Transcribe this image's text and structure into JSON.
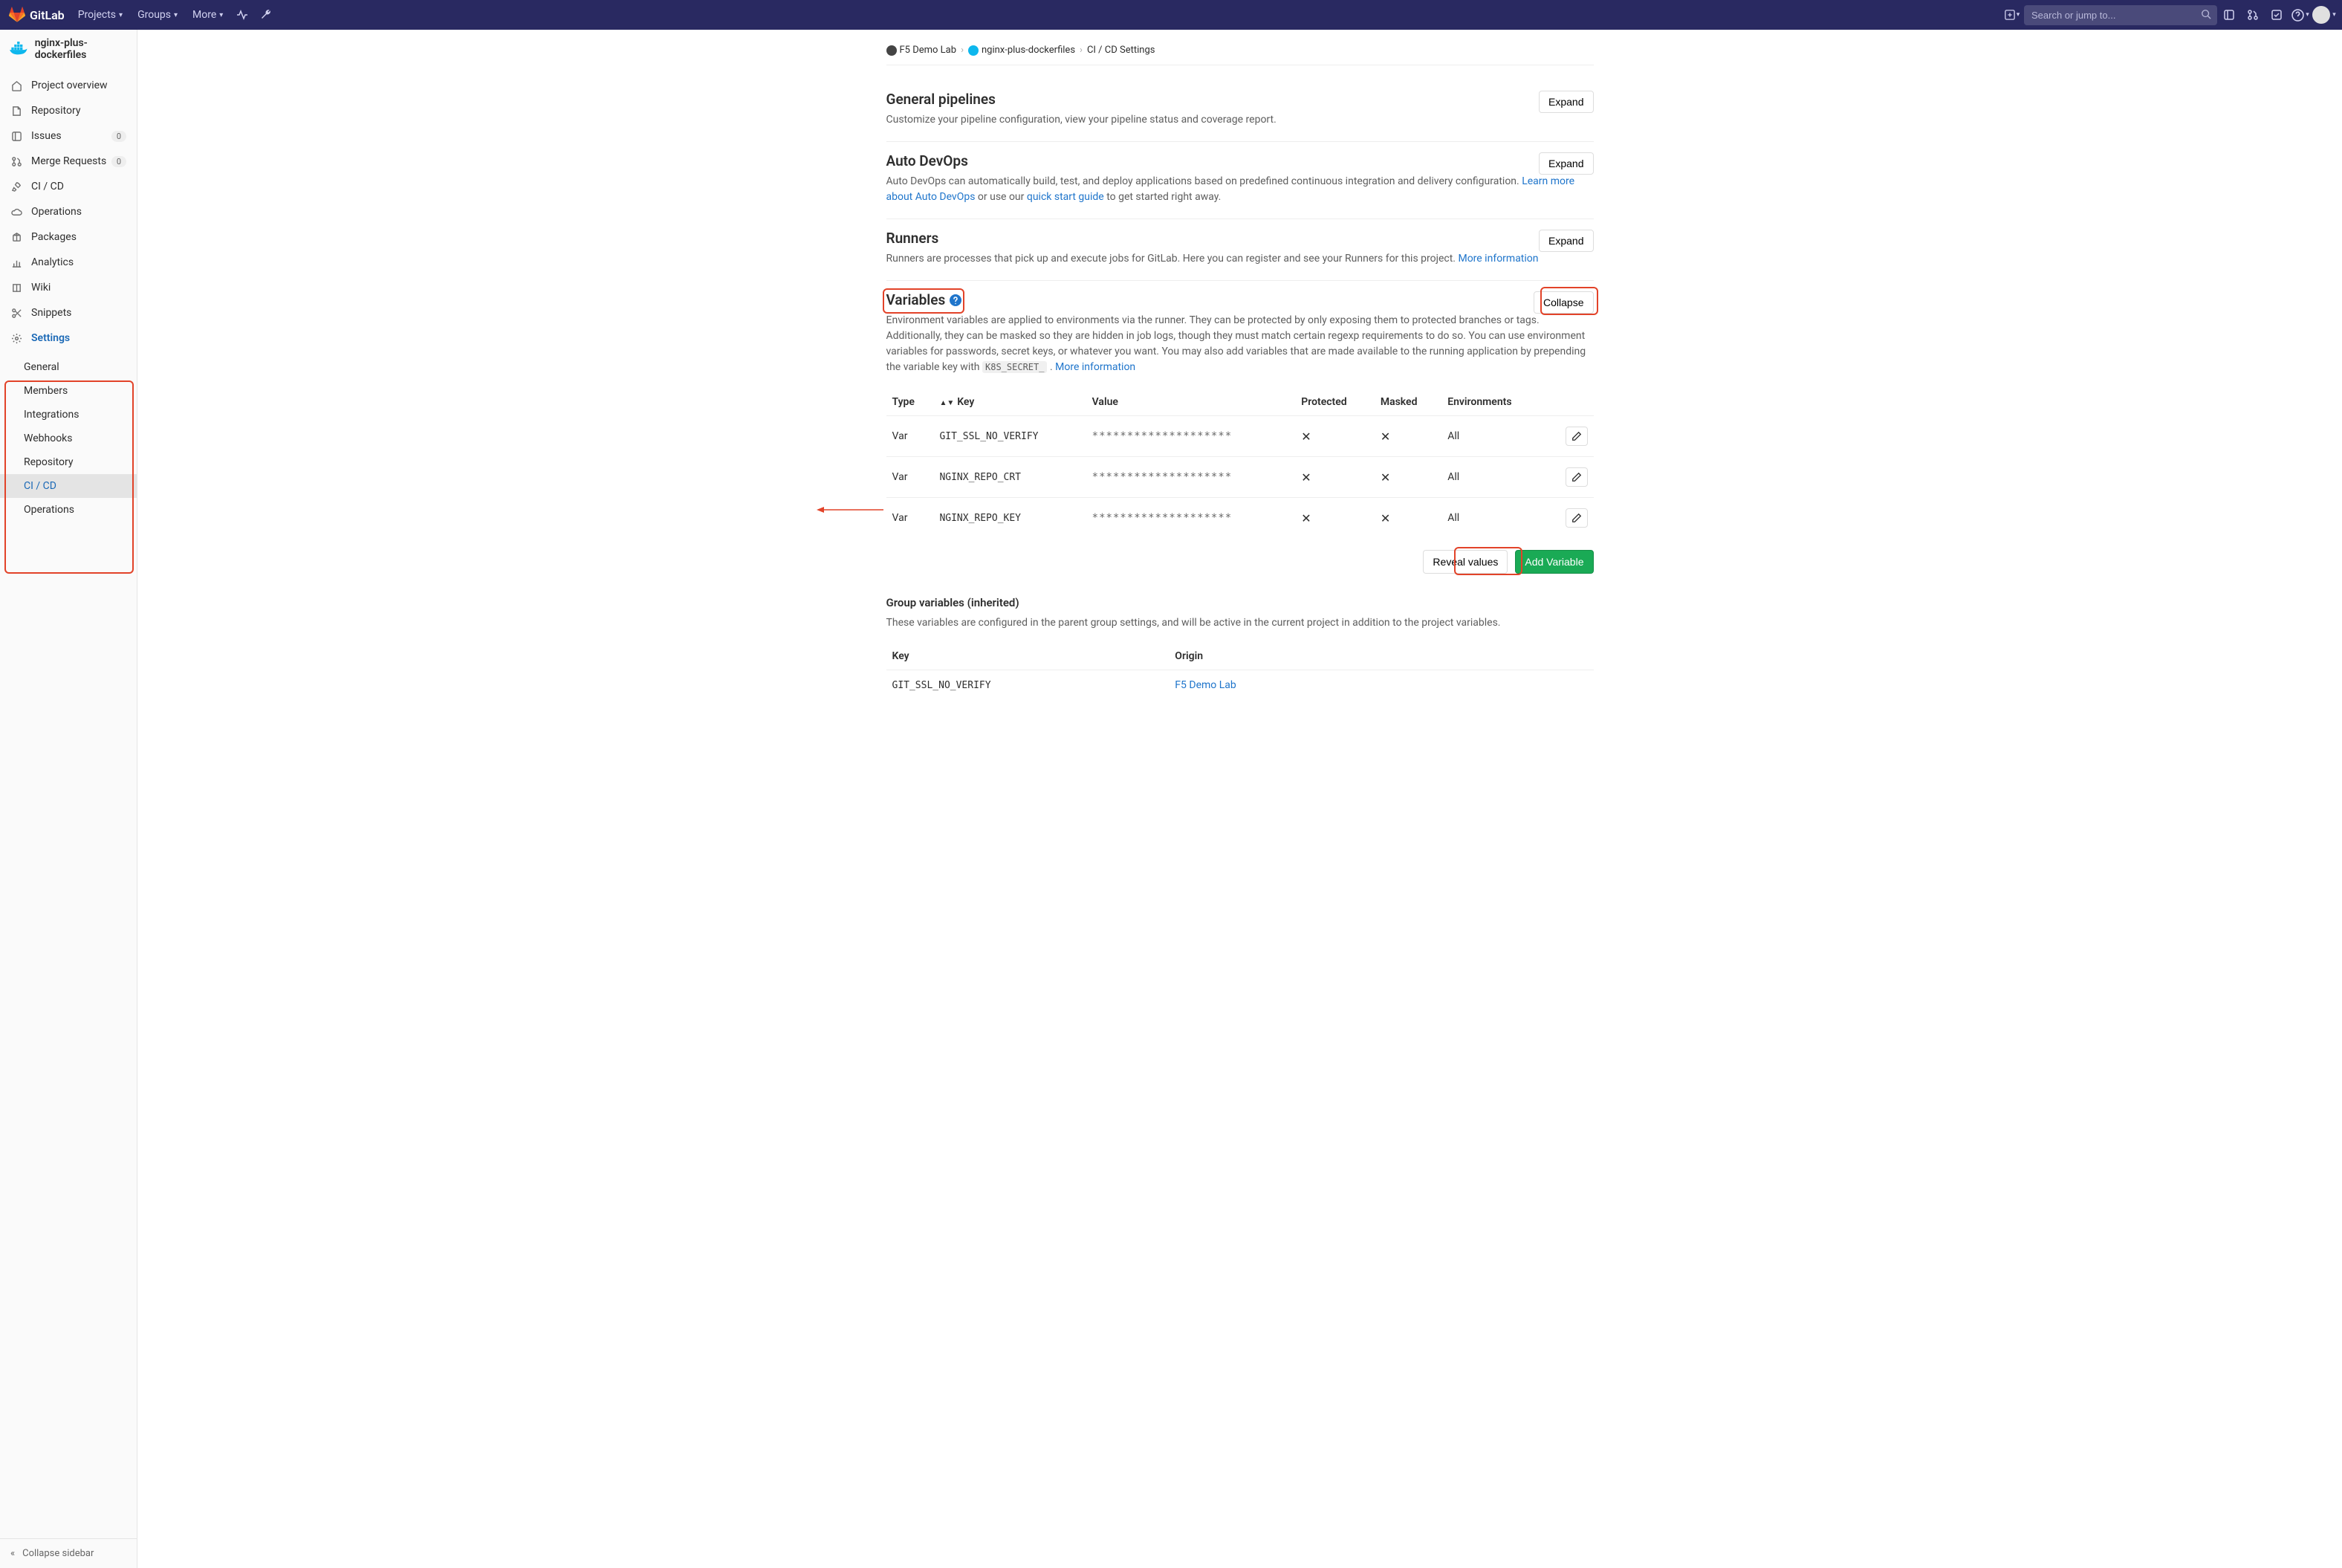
{
  "topnav": {
    "brand": "GitLab",
    "items": [
      "Projects",
      "Groups",
      "More"
    ],
    "search_placeholder": "Search or jump to..."
  },
  "sidebar": {
    "project_name": "nginx-plus-dockerfiles",
    "items": [
      {
        "label": "Project overview",
        "icon": "home",
        "badge": null
      },
      {
        "label": "Repository",
        "icon": "file",
        "badge": null
      },
      {
        "label": "Issues",
        "icon": "issues",
        "badge": "0"
      },
      {
        "label": "Merge Requests",
        "icon": "merge",
        "badge": "0"
      },
      {
        "label": "CI / CD",
        "icon": "rocket",
        "badge": null
      },
      {
        "label": "Operations",
        "icon": "cloud",
        "badge": null
      },
      {
        "label": "Packages",
        "icon": "package",
        "badge": null
      },
      {
        "label": "Analytics",
        "icon": "chart",
        "badge": null
      },
      {
        "label": "Wiki",
        "icon": "book",
        "badge": null
      },
      {
        "label": "Snippets",
        "icon": "scissors",
        "badge": null
      },
      {
        "label": "Settings",
        "icon": "gear",
        "badge": null,
        "active": true
      }
    ],
    "subitems": [
      "General",
      "Members",
      "Integrations",
      "Webhooks",
      "Repository",
      "CI / CD",
      "Operations"
    ],
    "active_sub": "CI / CD",
    "collapse_label": "Collapse sidebar"
  },
  "breadcrumbs": {
    "crumb1": "F5 Demo Lab",
    "crumb2": "nginx-plus-dockerfiles",
    "crumb3": "CI / CD Settings"
  },
  "sections": {
    "general": {
      "title": "General pipelines",
      "desc": "Customize your pipeline configuration, view your pipeline status and coverage report.",
      "button": "Expand"
    },
    "autodevops": {
      "title": "Auto DevOps",
      "desc1": "Auto DevOps can automatically build, test, and deploy applications based on predefined continuous integration and delivery configuration. ",
      "link1": "Learn more about Auto DevOps",
      "desc2": " or use our ",
      "link2": "quick start guide",
      "desc3": " to get started right away.",
      "button": "Expand"
    },
    "runners": {
      "title": "Runners",
      "desc1": "Runners are processes that pick up and execute jobs for GitLab. Here you can register and see your Runners for this project. ",
      "link1": "More information",
      "button": "Expand"
    },
    "variables": {
      "title": "Variables",
      "desc1": "Environment variables are applied to environments via the runner. They can be protected by only exposing them to protected branches or tags. Additionally, they can be masked so they are hidden in job logs, though they must match certain regexp requirements to do so. You can use environment variables for passwords, secret keys, or whatever you want. You may also add variables that are made available to the running application by prepending the variable key with ",
      "code": "K8S_SECRET_",
      "desc2": " . ",
      "link": "More information",
      "button": "Collapse",
      "headers": {
        "type": "Type",
        "key": "Key",
        "value": "Value",
        "protected": "Protected",
        "masked": "Masked",
        "environments": "Environments"
      },
      "rows": [
        {
          "type": "Var",
          "key": "GIT_SSL_NO_VERIFY",
          "value": "********************",
          "protected": "✕",
          "masked": "✕",
          "env": "All"
        },
        {
          "type": "Var",
          "key": "NGINX_REPO_CRT",
          "value": "********************",
          "protected": "✕",
          "masked": "✕",
          "env": "All"
        },
        {
          "type": "Var",
          "key": "NGINX_REPO_KEY",
          "value": "********************",
          "protected": "✕",
          "masked": "✕",
          "env": "All"
        }
      ],
      "reveal": "Reveal values",
      "add": "Add Variable"
    },
    "group": {
      "title": "Group variables (inherited)",
      "desc": "These variables are configured in the parent group settings, and will be active in the current project in addition to the project variables.",
      "headers": {
        "key": "Key",
        "origin": "Origin"
      },
      "rows": [
        {
          "key": "GIT_SSL_NO_VERIFY",
          "origin": "F5 Demo Lab"
        }
      ]
    }
  }
}
